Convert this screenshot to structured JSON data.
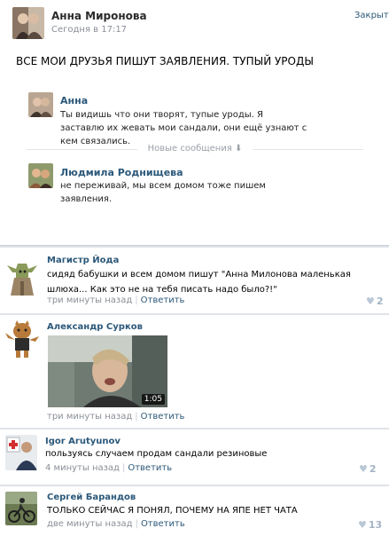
{
  "post": {
    "author": "Анна Миронова",
    "time": "Сегодня в 17:17",
    "close_label": "Закрыть",
    "text": "ВСЕ МОИ ДРУЗЬЯ ПИШУТ ЗАЯВЛЕНИЯ. ТУПЫЙ УРОДЫ",
    "messages": [
      {
        "name": "Анна",
        "text": "Ты видишь что они творят, тупые уроды. Я заставлю их жевать мои сандали, они ещё узнают с кем связались."
      },
      {
        "name": "Людмила Роднищева",
        "text": "не переживай, мы всем домом тоже пишем заявления."
      }
    ],
    "new_messages_label": "Новые сообщения ⬇"
  },
  "comments": [
    {
      "name": "Магистр Йода",
      "text": "сидяд бабушки и всем домом пишут \"Анна Милонова маленькая шлюха... Как это не на тебя писать надо было?!\"",
      "time": "три минуты назад",
      "reply": "Ответить",
      "likes": "2"
    },
    {
      "name": "Александр Сурков",
      "video_duration": "1:05",
      "time": "три минуты назад",
      "reply": "Ответить",
      "likes": ""
    },
    {
      "name": "Igor Arutyunov",
      "text": "пользуясь случаем продам сандали резиновые",
      "time": "4 минуты назад",
      "reply": "Ответить",
      "likes": "2"
    },
    {
      "name": "Сергей Барандов",
      "text": "ТОЛЬКО СЕЙЧАС Я ПОНЯЛ, ПОЧЕМУ НА ЯПЕ НЕТ ЧАТА",
      "time": "две минуты назад",
      "reply": "Ответить",
      "likes": "13"
    }
  ],
  "colors": {
    "link": "#2b587a",
    "meta": "#8a8f96",
    "background": "#dfe3e8"
  }
}
